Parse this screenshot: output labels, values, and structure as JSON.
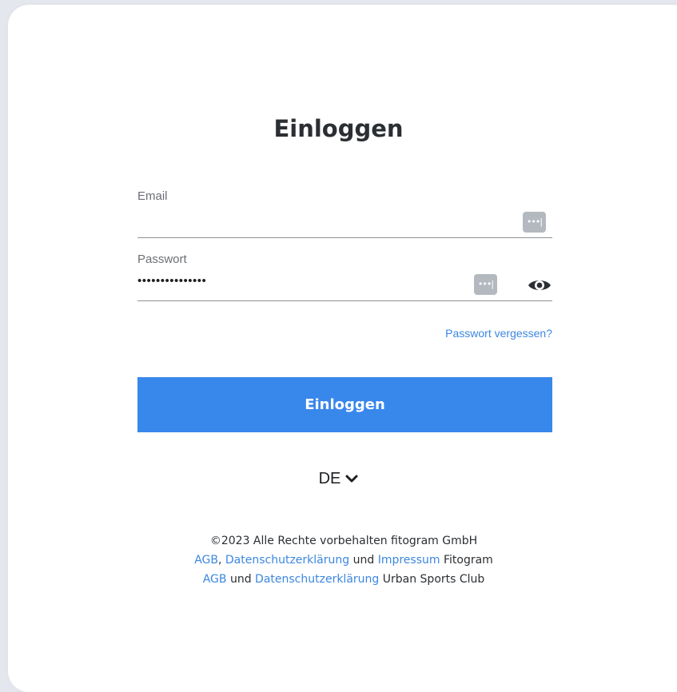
{
  "title": "Einloggen",
  "email": {
    "label": "Email",
    "value": ""
  },
  "password": {
    "label": "Passwort",
    "value": "•••••••••••••••"
  },
  "autofill_icon_text": "•••|",
  "forgot_link": "Passwort vergessen?",
  "login_button": "Einloggen",
  "language": {
    "selected": "DE"
  },
  "footer": {
    "line1": "©2023 Alle Rechte vorbehalten fitogram GmbH",
    "line2": {
      "agb": "AGB",
      "sep": ",",
      "privacy": "Datenschutzerklärung",
      "und": "und",
      "imprint": "Impressum",
      "suffix": "Fitogram"
    },
    "line3": {
      "agb": "AGB",
      "und": "und",
      "privacy": "Datenschutzerklärung",
      "suffix": "Urban Sports Club"
    }
  },
  "colors": {
    "accent": "#3887eb",
    "link": "#3c87e0",
    "background": "#e4e7ed"
  }
}
